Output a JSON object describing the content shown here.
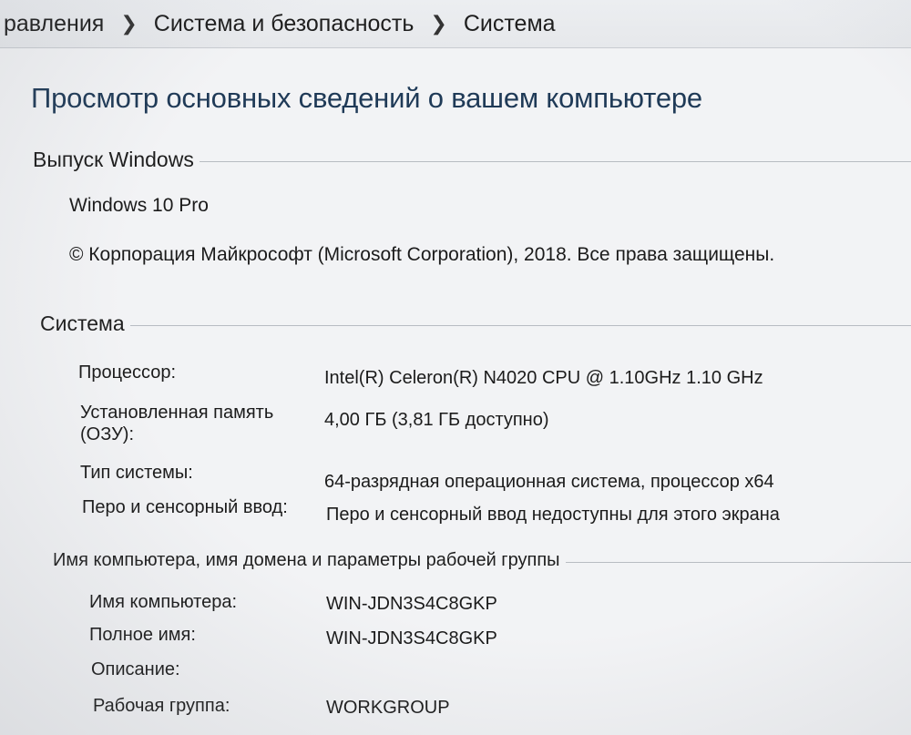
{
  "breadcrumb": {
    "items": [
      "равления",
      "Система и безопасность",
      "Система"
    ]
  },
  "page_title": "Просмотр основных сведений о вашем компьютере",
  "windows_edition": {
    "heading": "Выпуск Windows",
    "edition": "Windows 10 Pro",
    "copyright": "© Корпорация Майкрософт (Microsoft Corporation), 2018. Все права защищены."
  },
  "system": {
    "heading": "Система",
    "rows": [
      {
        "label": "Процессор:",
        "value": "Intel(R) Celeron(R) N4020 CPU @ 1.10GHz   1.10 GHz"
      },
      {
        "label": "Установленная память",
        "label2": "(ОЗУ):",
        "value": "4,00 ГБ (3,81 ГБ доступно)"
      },
      {
        "label": "Тип системы:",
        "value": "64-разрядная операционная система, процессор x64"
      },
      {
        "label": "Перо и сенсорный ввод:",
        "value": "Перо и сенсорный ввод недоступны для этого экрана"
      }
    ]
  },
  "computer_name": {
    "heading": "Имя компьютера, имя домена и параметры рабочей группы",
    "rows": [
      {
        "label": "Имя компьютера:",
        "value": "WIN-JDN3S4C8GKP"
      },
      {
        "label": "Полное имя:",
        "value": "WIN-JDN3S4C8GKP"
      },
      {
        "label": "Описание:",
        "value": ""
      },
      {
        "label": "Рабочая группа:",
        "value": "WORKGROUP"
      }
    ]
  }
}
